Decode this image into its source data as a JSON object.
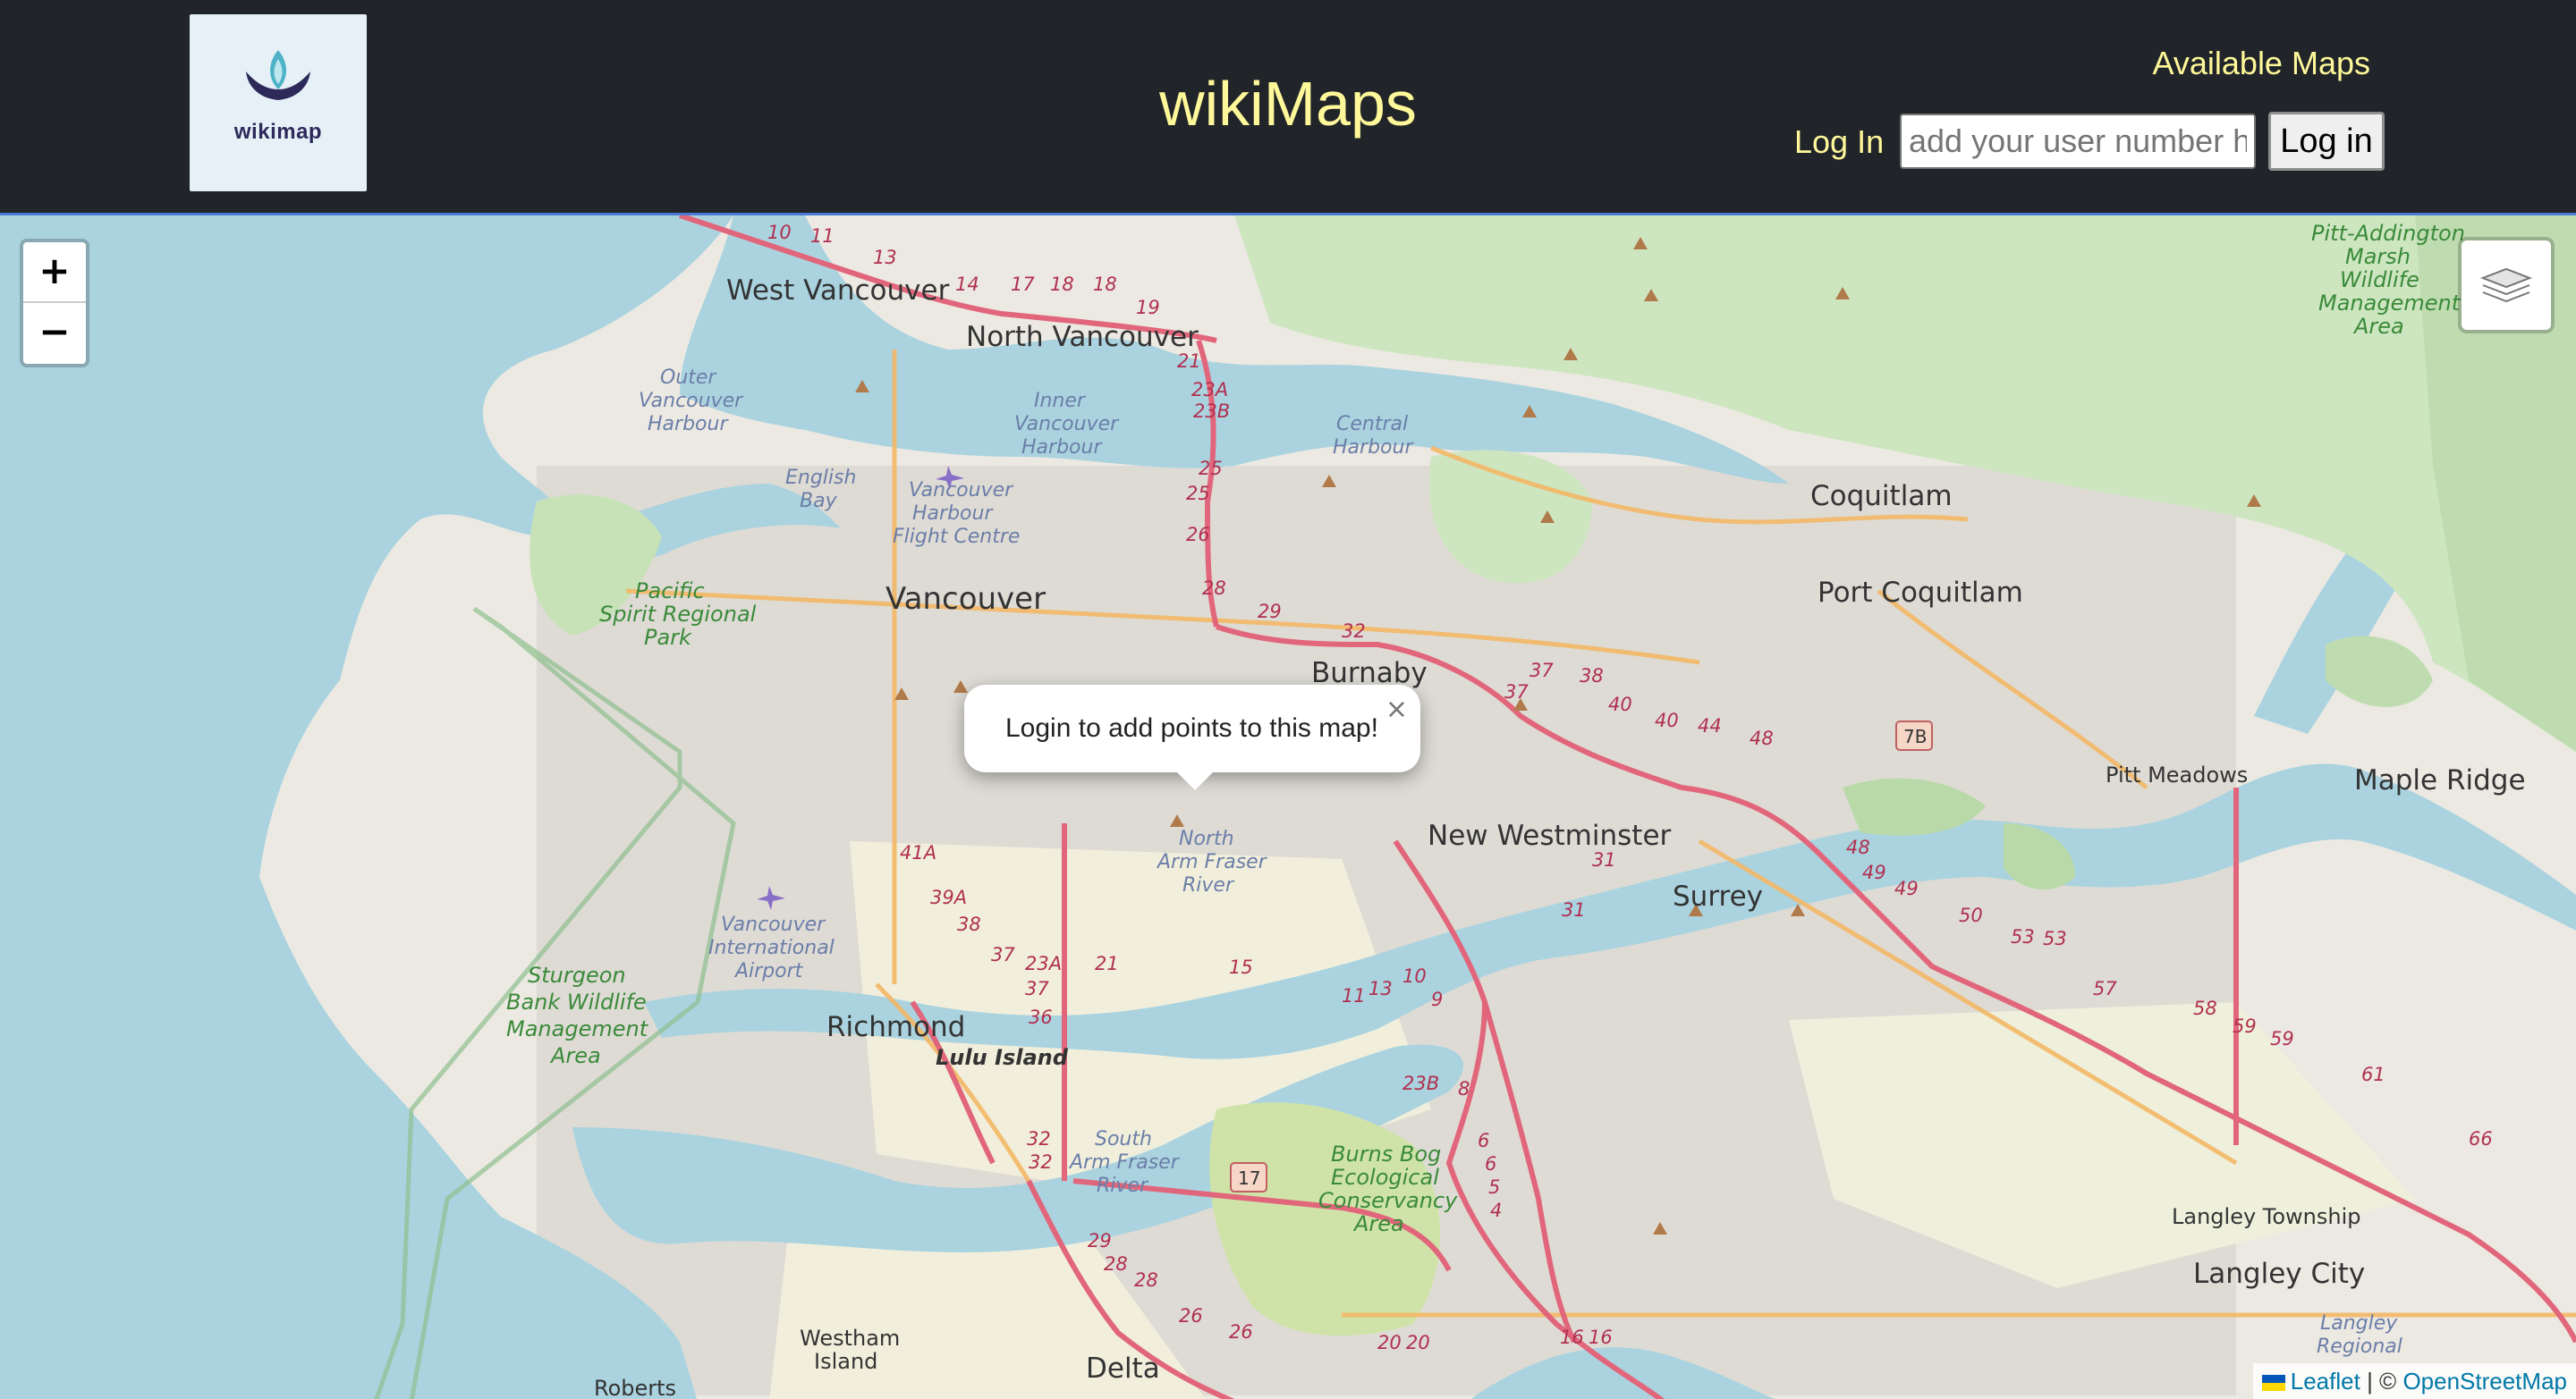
{
  "header": {
    "logo_text": "wikimap",
    "title": "wikiMaps",
    "nav_available_maps": "Available Maps",
    "login_label": "Log In",
    "user_input_placeholder": "add your user number here",
    "login_button": "Log in"
  },
  "map": {
    "zoom_in": "+",
    "zoom_out": "−",
    "popup_text": "Login to add points to this map!",
    "popup_close": "×",
    "attribution": {
      "leaflet": "Leaflet",
      "separator": " | © ",
      "osm": "OpenStreetMap"
    },
    "places": {
      "west_vancouver": "West Vancouver",
      "north_vancouver": "North Vancouver",
      "vancouver": "Vancouver",
      "burnaby": "Burnaby",
      "coquitlam": "Coquitlam",
      "port_coquitlam": "Port Coquitlam",
      "new_westminster": "New Westminster",
      "surrey": "Surrey",
      "richmond": "Richmond",
      "lulu_island": "Lulu Island",
      "delta": "Delta",
      "pitt_meadows": "Pitt Meadows",
      "maple_ridge": "Maple Ridge",
      "langley_township": "Langley Township",
      "langley_city": "Langley City",
      "westham_island_1": "Westham",
      "westham_island_2": "Island",
      "roberts": "Roberts"
    },
    "water_labels": {
      "outer_harbour_1": "Outer",
      "outer_harbour_2": "Vancouver",
      "outer_harbour_3": "Harbour",
      "inner_harbour_1": "Inner",
      "inner_harbour_2": "Vancouver",
      "inner_harbour_3": "Harbour",
      "central_harbour_1": "Central",
      "central_harbour_2": "Harbour",
      "english_bay_1": "English",
      "english_bay_2": "Bay",
      "north_arm_1": "North",
      "north_arm_2": "Arm Fraser",
      "north_arm_3": "River",
      "south_arm_1": "South",
      "south_arm_2": "Arm Fraser",
      "south_arm_3": "River",
      "harbour_flight_1": "Vancouver",
      "harbour_flight_2": "Harbour",
      "harbour_flight_3": "Flight Centre",
      "airport_1": "Vancouver",
      "airport_2": "International",
      "airport_3": "Airport"
    },
    "park_labels": {
      "pacific_spirit_1": "Pacific",
      "pacific_spirit_2": "Spirit Regional",
      "pacific_spirit_3": "Park",
      "sturgeon_1": "Sturgeon",
      "sturgeon_2": "Bank Wildlife",
      "sturgeon_3": "Management",
      "sturgeon_4": "Area",
      "burns_bog_1": "Burns Bog",
      "burns_bog_2": "Ecological",
      "burns_bog_3": "Conservancy",
      "burns_bog_4": "Area",
      "pitt_addington_1": "Pitt-Addington",
      "pitt_addington_2": "Marsh",
      "pitt_addington_3": "Wildlife",
      "pitt_addington_4": "Management",
      "pitt_addington_5": "Area",
      "langley_regional_1": "Langley",
      "langley_regional_2": "Regional"
    },
    "road_numbers": {
      "r1": "10",
      "r2": "11",
      "r3": "13",
      "r4": "14",
      "r5": "17",
      "r6": "18",
      "r7": "18",
      "r8": "19",
      "r9": "21",
      "r10": "23A",
      "r11": "23B",
      "r12": "25",
      "r13": "25",
      "r14": "26",
      "r15": "28",
      "r16": "29",
      "r17": "32",
      "r18": "37",
      "r19": "38",
      "r20": "37",
      "r21": "40",
      "r22": "40",
      "r23": "44",
      "r24": "48",
      "r25": "7B",
      "r26": "41A",
      "r27": "39A",
      "r28": "38",
      "r29": "37",
      "r30": "23A",
      "r31": "21",
      "r32": "37",
      "r33": "36",
      "r34": "15",
      "r35": "11",
      "r36": "13",
      "r37": "10",
      "r38": "9",
      "r39": "31",
      "r40": "31",
      "r41": "48",
      "r42": "49",
      "r43": "49",
      "r44": "50",
      "r45": "53",
      "r46": "53",
      "r47": "57",
      "r48": "58",
      "r49": "59",
      "r50": "59",
      "r51": "61",
      "r52": "66",
      "r53": "23B",
      "r54": "8",
      "r55": "6",
      "r56": "6",
      "r57": "5",
      "r58": "4",
      "r59": "17",
      "r60": "32",
      "r61": "32",
      "r62": "29",
      "r63": "28",
      "r64": "28",
      "r65": "26",
      "r66": "26",
      "r67": "20",
      "r68": "20",
      "r69": "16",
      "r70": "16"
    }
  }
}
